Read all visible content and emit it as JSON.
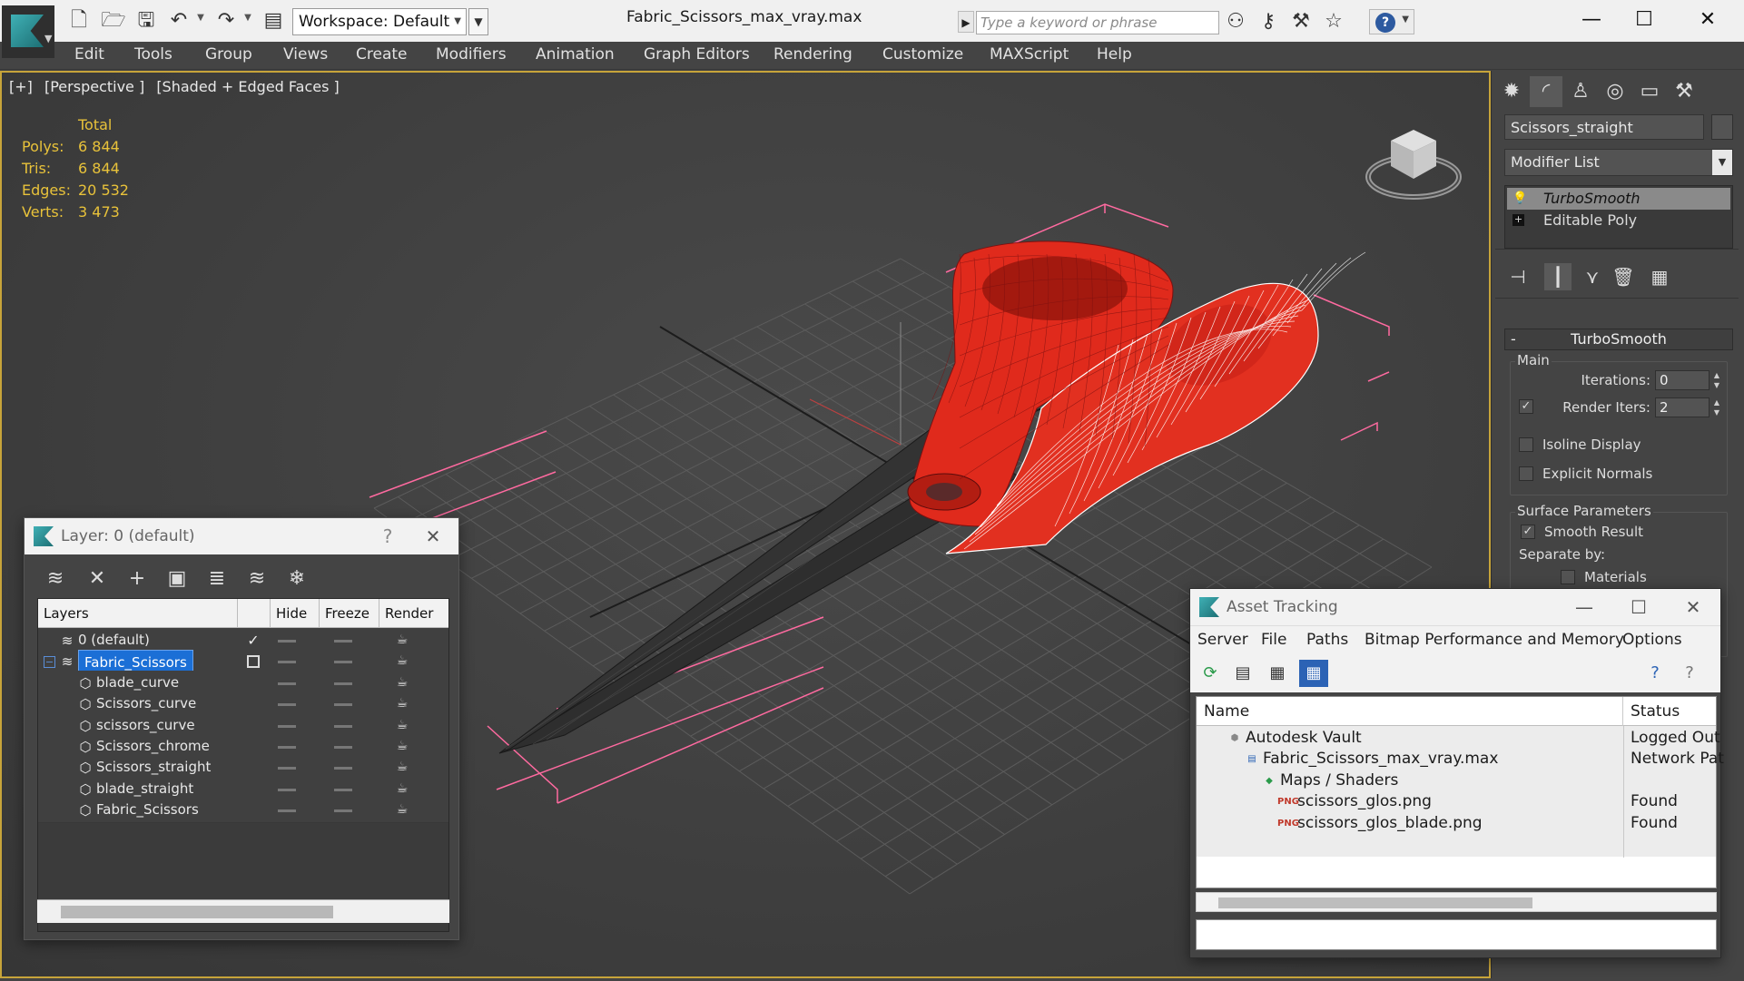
{
  "window": {
    "title": "Fabric_Scissors_max_vray.max",
    "workspace_label": "Workspace: Default",
    "search_placeholder": "Type a keyword or phrase"
  },
  "icons": {
    "app": "3dsmax-logo-icon",
    "quick_access": [
      "new-file-icon",
      "open-file-icon",
      "save-icon",
      "undo-icon",
      "redo-icon",
      "project-folder-icon"
    ],
    "search_tools": [
      "binoculars-icon",
      "key-icon",
      "wrench-icon",
      "star-icon",
      "help-icon"
    ],
    "command_tabs": [
      "create-icon",
      "modify-icon",
      "hierarchy-icon",
      "motion-icon",
      "display-icon",
      "utilities-icon"
    ]
  },
  "menu": [
    "Edit",
    "Tools",
    "Group",
    "Views",
    "Create",
    "Modifiers",
    "Animation",
    "Graph Editors",
    "Rendering",
    "Customize",
    "MAXScript",
    "Help"
  ],
  "viewport": {
    "labels": [
      "[+]",
      "[Perspective ]",
      "[Shaded + Edged Faces ]"
    ],
    "stats": {
      "header": "Total",
      "rows": [
        {
          "label": "Polys:",
          "value": "6 844"
        },
        {
          "label": "Tris:",
          "value": "6 844"
        },
        {
          "label": "Edges:",
          "value": "20 532"
        },
        {
          "label": "Verts:",
          "value": "3 473"
        }
      ]
    },
    "colors": {
      "stats": "#e8c23a",
      "selection": "#ff6aa0",
      "model": "#e02a1c",
      "grid": "#5a5a5a"
    }
  },
  "command_panel": {
    "object_name": "Scissors_straight",
    "modifier_list": "Modifier List",
    "stack": [
      "TurboSmooth",
      "Editable Poly"
    ],
    "rollout": {
      "title": "TurboSmooth",
      "main_group": "Main",
      "iterations_label": "Iterations:",
      "iterations": "0",
      "render_iters_label": "Render Iters:",
      "render_iters": "2",
      "render_iters_checked": true,
      "isoline_display": "Isoline Display",
      "explicit_normals": "Explicit Normals",
      "surface_group": "Surface Parameters",
      "smooth_result": "Smooth Result",
      "separate_by": "Separate by:",
      "materials": "Materials"
    }
  },
  "layer_dialog": {
    "title": "Layer: 0 (default)",
    "help": "?",
    "close": "✕",
    "columns": [
      "Layers",
      "Hide",
      "Freeze",
      "Render"
    ],
    "rows": [
      {
        "name": "0 (default)",
        "level": 0,
        "type": "layer"
      },
      {
        "name": "Fabric_Scissors",
        "level": 0,
        "type": "layer",
        "selected": true
      },
      {
        "name": "blade_curve",
        "level": 1,
        "type": "object"
      },
      {
        "name": "Scissors_curve",
        "level": 1,
        "type": "object"
      },
      {
        "name": "scissors_curve",
        "level": 1,
        "type": "object"
      },
      {
        "name": "Scissors_chrome",
        "level": 1,
        "type": "object"
      },
      {
        "name": "Scissors_straight",
        "level": 1,
        "type": "object"
      },
      {
        "name": "blade_straight",
        "level": 1,
        "type": "object"
      },
      {
        "name": "Fabric_Scissors",
        "level": 1,
        "type": "object"
      }
    ]
  },
  "asset_dialog": {
    "title": "Asset Tracking",
    "menu": [
      "Server",
      "File",
      "Paths",
      "Bitmap Performance and Memory",
      "Options"
    ],
    "columns": [
      "Name",
      "Status"
    ],
    "rows": [
      {
        "name": "Autodesk Vault",
        "status": "Logged Out",
        "indent": 0,
        "icon": "vault-icon"
      },
      {
        "name": "Fabric_Scissors_max_vray.max",
        "status": "Network Pat",
        "indent": 1,
        "icon": "max-file-icon"
      },
      {
        "name": "Maps / Shaders",
        "status": "",
        "indent": 2,
        "icon": "maps-icon"
      },
      {
        "name": "scissors_glos.png",
        "status": "Found",
        "indent": 3,
        "icon": "png-icon"
      },
      {
        "name": "scissors_glos_blade.png",
        "status": "Found",
        "indent": 3,
        "icon": "png-icon"
      }
    ]
  }
}
